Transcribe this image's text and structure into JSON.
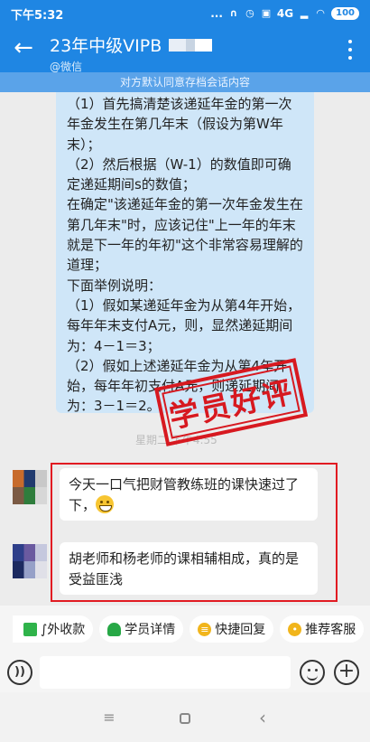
{
  "status": {
    "time": "下午5:32",
    "dots": "...",
    "network": "4G",
    "battery": "100"
  },
  "header": {
    "title": "23年中级VIPB",
    "subtitle": "@微信"
  },
  "notice": "对方默认同意存档会话内容",
  "messages": {
    "big": [
      "（1）首先搞清楚该递延年金的第一次年金发生在第几年末（假设为第W年末）；",
      "（2）然后根据（W-1）的数值即可确定递延期间s的数值；",
      "在确定\"该递延年金的第一次年金发生在第几年末\"时，应该记住\"上一年的年末就是下一年的年初\"这个非常容易理解的道理；",
      "下面举例说明：",
      "（1）假如某递延年金为从第4年开始，每年年末支付A元，则，显然递延期间为：4－1＝3；",
      "（2）假如上述递延年金为从第4年开始，每年年初支付A元，则递延期间为：3－1＝2。"
    ],
    "time": "星期二 下午4:55",
    "msg1": "今天一口气把财管教练班的课快速过了下，",
    "msg2": "胡老师和杨老师的课相辅相成，真的是受益匪浅"
  },
  "stamp": "学员好评",
  "quick_replies": [
    {
      "label": "∫外收款",
      "icon": "green-square-icon"
    },
    {
      "label": "学员详情",
      "icon": "person-icon"
    },
    {
      "label": "快捷回复",
      "icon": "quick-reply-icon"
    },
    {
      "label": "推荐客服",
      "icon": "recommend-icon"
    }
  ],
  "input": {
    "placeholder": ""
  },
  "colors": {
    "brand": "#1f86e3",
    "stamp": "#d71920",
    "bubble": "#cfe6f8"
  }
}
